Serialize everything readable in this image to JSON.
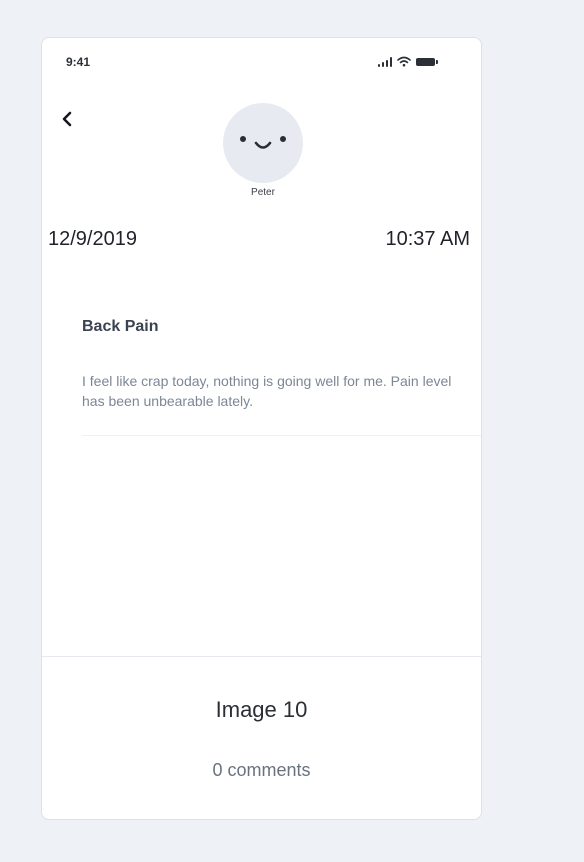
{
  "status_bar": {
    "time": "9:41",
    "icons": [
      "signal-icon",
      "wifi-icon",
      "battery-icon"
    ]
  },
  "header": {
    "back_icon": "chevron-left-icon",
    "avatar_icon": "smiley-face-icon",
    "user_name": "Peter"
  },
  "entry": {
    "date": "12/9/2019",
    "time": "10:37 AM",
    "title": "Back Pain",
    "body": "I feel like crap today, nothing is going well for me. Pain level has been unbearable lately."
  },
  "footer": {
    "image_label": "Image 10",
    "comments_label": "0 comments"
  },
  "colors": {
    "page_background": "#eef1f6",
    "card_background": "#ffffff",
    "body_text": "#7c8696",
    "title_text": "#3c4350"
  }
}
